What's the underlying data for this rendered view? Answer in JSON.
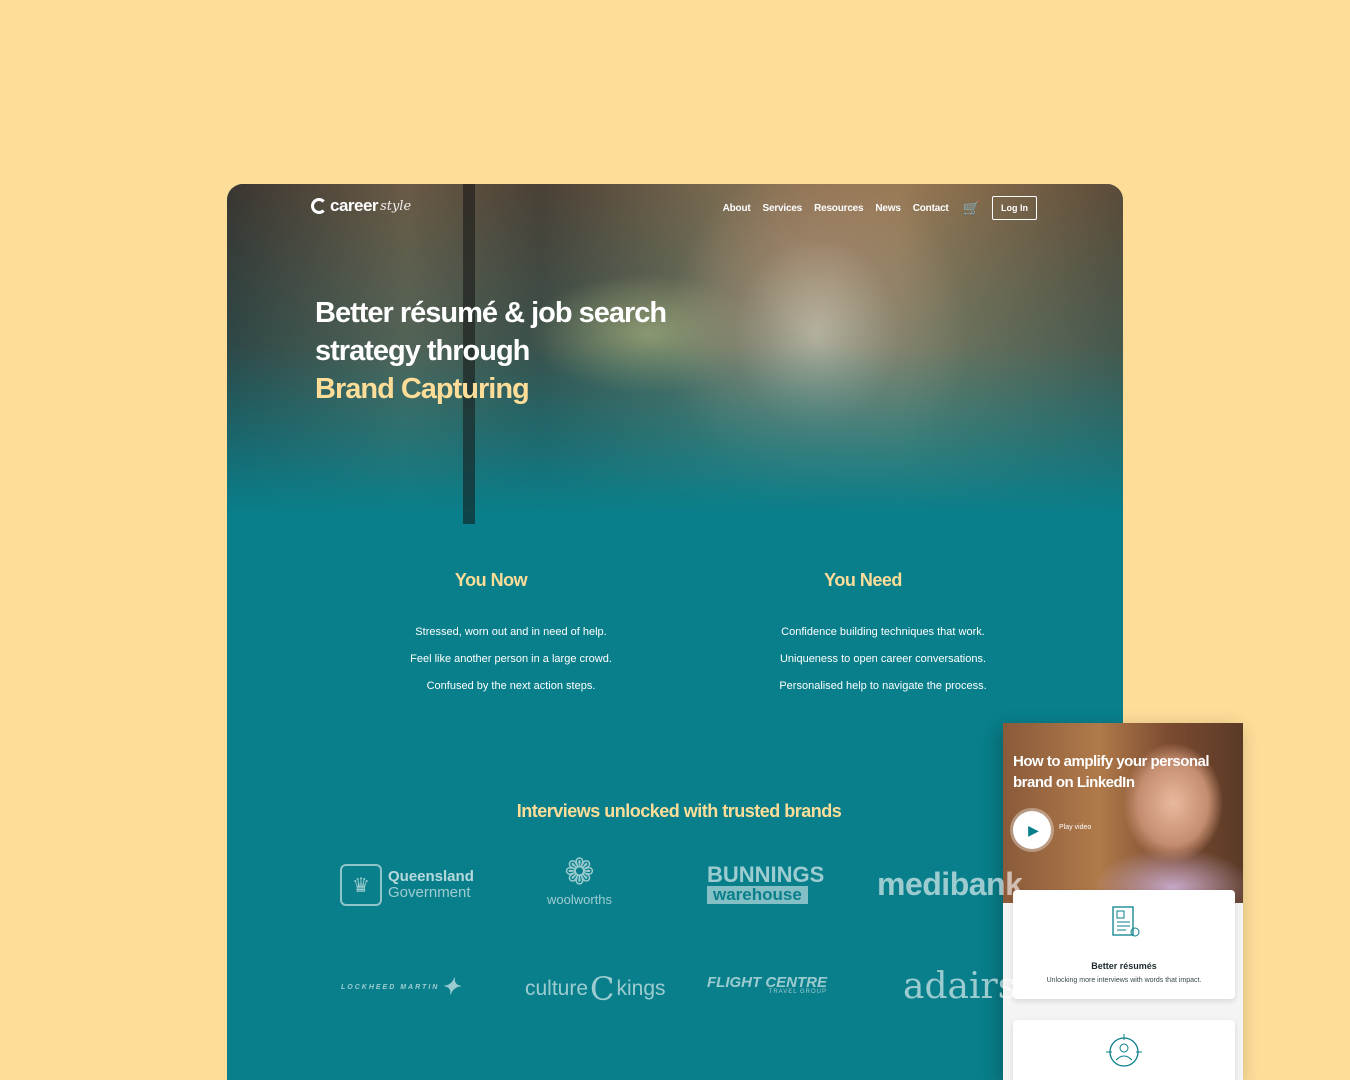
{
  "nav": {
    "logo_main": "career",
    "logo_sub": "style",
    "links": [
      "About",
      "Services",
      "Resources",
      "News",
      "Contact"
    ],
    "cart_icon": "cart-icon",
    "login": "Log In"
  },
  "hero": {
    "line1": "Better résumé & job search",
    "line2": "strategy through",
    "accent": "Brand Capturing"
  },
  "you_now": {
    "title": "You Now",
    "items": [
      "Stressed, worn out and in need of help.",
      "Feel like another person in a large crowd.",
      "Confused by the next action steps."
    ]
  },
  "you_need": {
    "title": "You Need",
    "items": [
      "Confidence building techniques that work.",
      "Uniqueness to open career conversations.",
      "Personalised help to navigate the process."
    ]
  },
  "brands": {
    "title": "Interviews unlocked with trusted brands",
    "queensland": [
      "Queensland",
      "Government"
    ],
    "woolworths": "woolworths",
    "bunnings": [
      "BUNNINGS",
      "warehouse"
    ],
    "medibank": "medibank",
    "lockheed": "LOCKHEED MARTIN",
    "culture_kings": [
      "culture",
      "C",
      "kings"
    ],
    "flight_centre": [
      "FLIGHT CENTRE",
      "TRAVEL GROUP"
    ],
    "adairs": "adairs"
  },
  "popup": {
    "title": "How to amplify your personal brand on LinkedIn",
    "play_label": "Play video",
    "card1_title": "Better résumés",
    "card1_text": "Unlocking more interviews with words that impact."
  },
  "colors": {
    "background": "#fddd98",
    "teal": "#087f8b",
    "accent": "#fddd98"
  }
}
